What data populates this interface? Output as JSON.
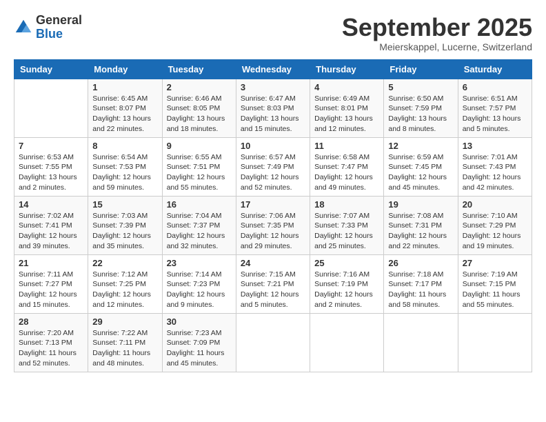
{
  "header": {
    "logo_general": "General",
    "logo_blue": "Blue",
    "month_title": "September 2025",
    "location": "Meierskappel, Lucerne, Switzerland"
  },
  "weekdays": [
    "Sunday",
    "Monday",
    "Tuesday",
    "Wednesday",
    "Thursday",
    "Friday",
    "Saturday"
  ],
  "weeks": [
    [
      {
        "day": "",
        "info": ""
      },
      {
        "day": "1",
        "info": "Sunrise: 6:45 AM\nSunset: 8:07 PM\nDaylight: 13 hours\nand 22 minutes."
      },
      {
        "day": "2",
        "info": "Sunrise: 6:46 AM\nSunset: 8:05 PM\nDaylight: 13 hours\nand 18 minutes."
      },
      {
        "day": "3",
        "info": "Sunrise: 6:47 AM\nSunset: 8:03 PM\nDaylight: 13 hours\nand 15 minutes."
      },
      {
        "day": "4",
        "info": "Sunrise: 6:49 AM\nSunset: 8:01 PM\nDaylight: 13 hours\nand 12 minutes."
      },
      {
        "day": "5",
        "info": "Sunrise: 6:50 AM\nSunset: 7:59 PM\nDaylight: 13 hours\nand 8 minutes."
      },
      {
        "day": "6",
        "info": "Sunrise: 6:51 AM\nSunset: 7:57 PM\nDaylight: 13 hours\nand 5 minutes."
      }
    ],
    [
      {
        "day": "7",
        "info": "Sunrise: 6:53 AM\nSunset: 7:55 PM\nDaylight: 13 hours\nand 2 minutes."
      },
      {
        "day": "8",
        "info": "Sunrise: 6:54 AM\nSunset: 7:53 PM\nDaylight: 12 hours\nand 59 minutes."
      },
      {
        "day": "9",
        "info": "Sunrise: 6:55 AM\nSunset: 7:51 PM\nDaylight: 12 hours\nand 55 minutes."
      },
      {
        "day": "10",
        "info": "Sunrise: 6:57 AM\nSunset: 7:49 PM\nDaylight: 12 hours\nand 52 minutes."
      },
      {
        "day": "11",
        "info": "Sunrise: 6:58 AM\nSunset: 7:47 PM\nDaylight: 12 hours\nand 49 minutes."
      },
      {
        "day": "12",
        "info": "Sunrise: 6:59 AM\nSunset: 7:45 PM\nDaylight: 12 hours\nand 45 minutes."
      },
      {
        "day": "13",
        "info": "Sunrise: 7:01 AM\nSunset: 7:43 PM\nDaylight: 12 hours\nand 42 minutes."
      }
    ],
    [
      {
        "day": "14",
        "info": "Sunrise: 7:02 AM\nSunset: 7:41 PM\nDaylight: 12 hours\nand 39 minutes."
      },
      {
        "day": "15",
        "info": "Sunrise: 7:03 AM\nSunset: 7:39 PM\nDaylight: 12 hours\nand 35 minutes."
      },
      {
        "day": "16",
        "info": "Sunrise: 7:04 AM\nSunset: 7:37 PM\nDaylight: 12 hours\nand 32 minutes."
      },
      {
        "day": "17",
        "info": "Sunrise: 7:06 AM\nSunset: 7:35 PM\nDaylight: 12 hours\nand 29 minutes."
      },
      {
        "day": "18",
        "info": "Sunrise: 7:07 AM\nSunset: 7:33 PM\nDaylight: 12 hours\nand 25 minutes."
      },
      {
        "day": "19",
        "info": "Sunrise: 7:08 AM\nSunset: 7:31 PM\nDaylight: 12 hours\nand 22 minutes."
      },
      {
        "day": "20",
        "info": "Sunrise: 7:10 AM\nSunset: 7:29 PM\nDaylight: 12 hours\nand 19 minutes."
      }
    ],
    [
      {
        "day": "21",
        "info": "Sunrise: 7:11 AM\nSunset: 7:27 PM\nDaylight: 12 hours\nand 15 minutes."
      },
      {
        "day": "22",
        "info": "Sunrise: 7:12 AM\nSunset: 7:25 PM\nDaylight: 12 hours\nand 12 minutes."
      },
      {
        "day": "23",
        "info": "Sunrise: 7:14 AM\nSunset: 7:23 PM\nDaylight: 12 hours\nand 9 minutes."
      },
      {
        "day": "24",
        "info": "Sunrise: 7:15 AM\nSunset: 7:21 PM\nDaylight: 12 hours\nand 5 minutes."
      },
      {
        "day": "25",
        "info": "Sunrise: 7:16 AM\nSunset: 7:19 PM\nDaylight: 12 hours\nand 2 minutes."
      },
      {
        "day": "26",
        "info": "Sunrise: 7:18 AM\nSunset: 7:17 PM\nDaylight: 11 hours\nand 58 minutes."
      },
      {
        "day": "27",
        "info": "Sunrise: 7:19 AM\nSunset: 7:15 PM\nDaylight: 11 hours\nand 55 minutes."
      }
    ],
    [
      {
        "day": "28",
        "info": "Sunrise: 7:20 AM\nSunset: 7:13 PM\nDaylight: 11 hours\nand 52 minutes."
      },
      {
        "day": "29",
        "info": "Sunrise: 7:22 AM\nSunset: 7:11 PM\nDaylight: 11 hours\nand 48 minutes."
      },
      {
        "day": "30",
        "info": "Sunrise: 7:23 AM\nSunset: 7:09 PM\nDaylight: 11 hours\nand 45 minutes."
      },
      {
        "day": "",
        "info": ""
      },
      {
        "day": "",
        "info": ""
      },
      {
        "day": "",
        "info": ""
      },
      {
        "day": "",
        "info": ""
      }
    ]
  ]
}
